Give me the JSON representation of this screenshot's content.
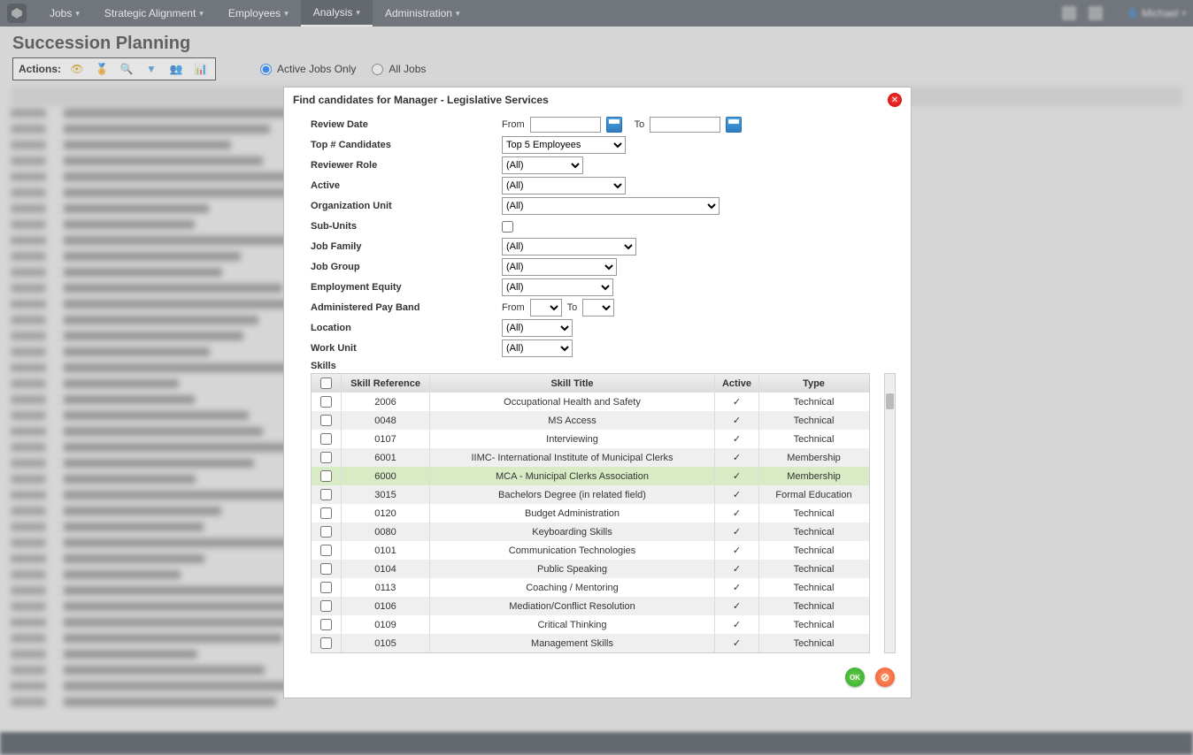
{
  "topnav": {
    "items": [
      "Jobs",
      "Strategic Alignment",
      "Employees",
      "Analysis",
      "Administration"
    ],
    "active_index": 3,
    "user": "Michael"
  },
  "page": {
    "title": "Succession Planning",
    "actions_label": "Actions:",
    "radio_active": "Active Jobs Only",
    "radio_all": "All Jobs"
  },
  "modal": {
    "title": "Find candidates for Manager - Legislative Services",
    "labels": {
      "review_date": "Review Date",
      "from": "From",
      "to": "To",
      "top_candidates": "Top # Candidates",
      "reviewer_role": "Reviewer Role",
      "active": "Active",
      "org_unit": "Organization Unit",
      "sub_units": "Sub-Units",
      "job_family": "Job Family",
      "job_group": "Job Group",
      "emp_equity": "Employment Equity",
      "pay_band": "Administered Pay Band",
      "location": "Location",
      "work_unit": "Work Unit",
      "skills": "Skills"
    },
    "top_candidates_value": "Top 5 Employees",
    "all_option": "(All)",
    "skills_header": {
      "ref": "Skill Reference",
      "title": "Skill Title",
      "active": "Active",
      "type": "Type"
    },
    "skills": [
      {
        "ref": "2006",
        "title": "Occupational Health and Safety",
        "active": "✓",
        "type": "Technical"
      },
      {
        "ref": "0048",
        "title": "MS Access",
        "active": "✓",
        "type": "Technical"
      },
      {
        "ref": "0107",
        "title": "Interviewing",
        "active": "✓",
        "type": "Technical"
      },
      {
        "ref": "6001",
        "title": "IIMC- International Institute of Municipal Clerks",
        "active": "✓",
        "type": "Membership"
      },
      {
        "ref": "6000",
        "title": "MCA - Municipal Clerks Association",
        "active": "✓",
        "type": "Membership",
        "hl": true
      },
      {
        "ref": "3015",
        "title": "Bachelors Degree (in related field)",
        "active": "✓",
        "type": "Formal Education"
      },
      {
        "ref": "0120",
        "title": "Budget Administration",
        "active": "✓",
        "type": "Technical"
      },
      {
        "ref": "0080",
        "title": "Keyboarding Skills",
        "active": "✓",
        "type": "Technical"
      },
      {
        "ref": "0101",
        "title": "Communication Technologies",
        "active": "✓",
        "type": "Technical"
      },
      {
        "ref": "0104",
        "title": "Public Speaking",
        "active": "✓",
        "type": "Technical"
      },
      {
        "ref": "0113",
        "title": "Coaching / Mentoring",
        "active": "✓",
        "type": "Technical"
      },
      {
        "ref": "0106",
        "title": "Mediation/Conflict Resolution",
        "active": "✓",
        "type": "Technical"
      },
      {
        "ref": "0109",
        "title": "Critical Thinking",
        "active": "✓",
        "type": "Technical"
      },
      {
        "ref": "0105",
        "title": "Management Skills",
        "active": "✓",
        "type": "Technical"
      }
    ],
    "ok_label": "OK"
  }
}
